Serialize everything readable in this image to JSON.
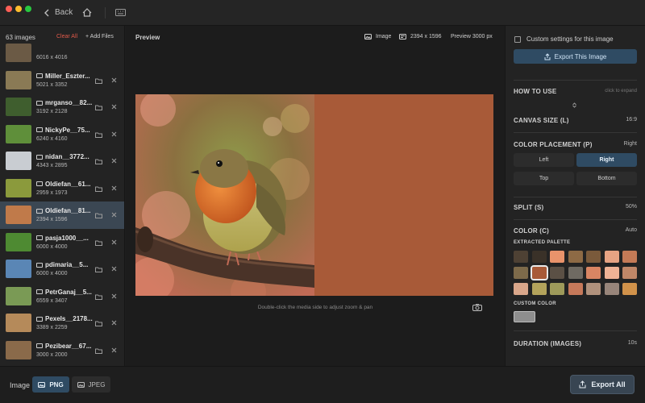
{
  "window": {
    "back_label": "Back"
  },
  "sidebar": {
    "count_label": "63 images",
    "clear_label": "Clear All",
    "add_label": "+ Add Files",
    "items": [
      {
        "name": "",
        "size": "6016 x 4016",
        "thumb": "#6b5a45",
        "active": false
      },
      {
        "name": "Miller_Eszter...",
        "size": "5021 x 3352",
        "thumb": "#8a7a55",
        "active": false
      },
      {
        "name": "mrganso__82...",
        "size": "3192 x 2128",
        "thumb": "#3f5e2e",
        "active": false
      },
      {
        "name": "NickyPe__75...",
        "size": "6240 x 4160",
        "thumb": "#5f8f3a",
        "active": false
      },
      {
        "name": "nidan__3772...",
        "size": "4343 x 2895",
        "thumb": "#c9cdd2",
        "active": false
      },
      {
        "name": "Oldiefan__61...",
        "size": "2959 x 1973",
        "thumb": "#8b9a3c",
        "active": false
      },
      {
        "name": "Oldiefan__81...",
        "size": "2394 x 1596",
        "thumb": "#c07a4a",
        "active": true
      },
      {
        "name": "pasja1000__...",
        "size": "6000 x 4000",
        "thumb": "#4e8a32",
        "active": false
      },
      {
        "name": "pdimaria__5...",
        "size": "6000 x 4000",
        "thumb": "#5a86b5",
        "active": false
      },
      {
        "name": "PetrGanaj__5...",
        "size": "6559 x 3407",
        "thumb": "#7a9a55",
        "active": false
      },
      {
        "name": "Pexels__2178...",
        "size": "3389 x 2259",
        "thumb": "#b58a5a",
        "active": false
      },
      {
        "name": "Pezibear__67...",
        "size": "3000 x 2000",
        "thumb": "#8a6a4a",
        "active": false
      },
      {
        "name": "",
        "size": "",
        "thumb": "#9a7a5a",
        "active": false
      }
    ]
  },
  "preview": {
    "title": "Preview",
    "type_label": "Image",
    "dimensions": "2394 x 1596",
    "preview_size": "Preview 3000 px",
    "hint": "Double-click the media side to adjust zoom & pan",
    "fill_color": "#a85a38"
  },
  "settings": {
    "custom_label": "Custom settings for this image",
    "export_this": "Export This Image",
    "how_to_use": "HOW TO USE",
    "click_to_expand": "click to expand",
    "canvas_size": "CANVAS SIZE (L)",
    "canvas_size_value": "16:9",
    "color_placement": "COLOR PLACEMENT (P)",
    "color_placement_value": "Right",
    "placement_options": [
      "Left",
      "Right",
      "Top",
      "Bottom"
    ],
    "placement_selected": 1,
    "split": "SPLIT (S)",
    "split_value": "50%",
    "color": "COLOR (C)",
    "color_value": "Auto",
    "extracted_palette": "EXTRACTED PALETTE",
    "palette": [
      "#4e4134",
      "#3a3128",
      "#e9936b",
      "#8d6a45",
      "#7a5a3b",
      "#e6a383",
      "#c47a56",
      "#7d6a4a",
      "#a85a38",
      "#5b5045",
      "#6f6a62",
      "#d98563",
      "#efb396",
      "#c08768",
      "#d9a68a",
      "#b3a35b",
      "#9e9a5a",
      "#c6795a",
      "#b0917c",
      "#98857a",
      "#d1924a"
    ],
    "palette_selected": 8,
    "custom_color": "CUSTOM COLOR",
    "duration": "DURATION (IMAGES)",
    "duration_value": "10s"
  },
  "bottom": {
    "format_label": "Image",
    "png_label": "PNG",
    "jpeg_label": "JPEG",
    "export_all": "Export All"
  }
}
